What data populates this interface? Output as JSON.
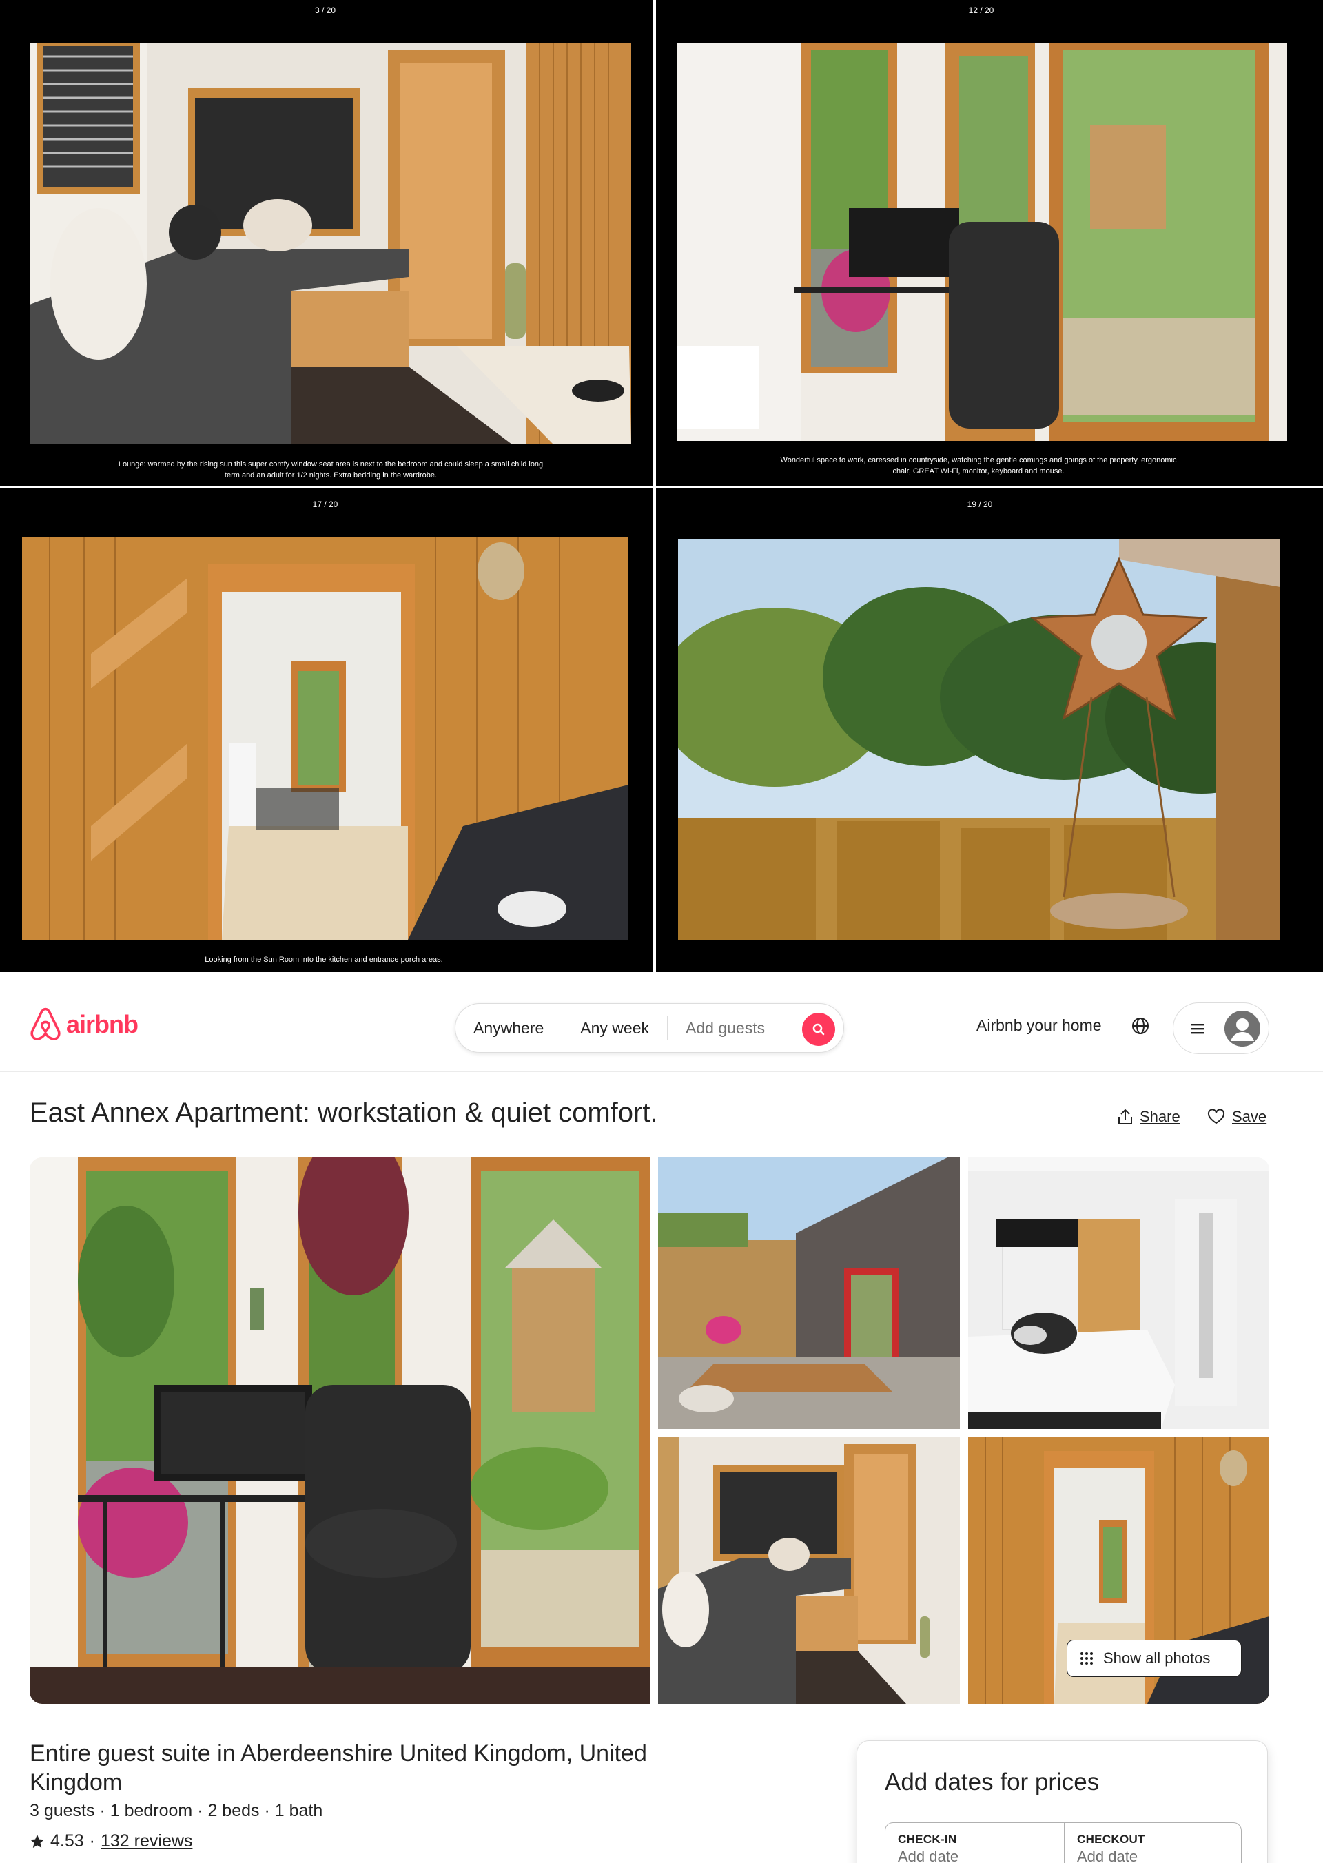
{
  "lightbox": {
    "panels": [
      {
        "counter": "3 / 20",
        "caption": "Lounge: warmed by the rising sun this super comfy window seat area is next to the bedroom and could sleep a small child long term and an adult for 1/2 nights. Extra bedding in the wardrobe."
      },
      {
        "counter": "12 / 20",
        "caption": "Wonderful space to work, caressed in countryside, watching the gentle comings and goings of the property, ergonomic chair, GREAT Wi-Fi, monitor, keyboard and mouse."
      },
      {
        "counter": "17 / 20",
        "caption": "Looking from the Sun Room into the kitchen and entrance porch areas."
      },
      {
        "counter": "19 / 20",
        "caption": ""
      }
    ]
  },
  "header": {
    "logo_text": "airbnb",
    "search": {
      "anywhere": "Anywhere",
      "any_week": "Any week",
      "add_guests": "Add guests"
    },
    "host_link": "Airbnb your home",
    "brand_color": "#ff385c"
  },
  "listing": {
    "title": "East Annex Apartment: workstation & quiet comfort.",
    "share_label": "Share",
    "save_label": "Save",
    "show_all_photos": "Show all photos",
    "type_location": "Entire guest suite in Aberdeenshire United Kingdom, United Kingdom",
    "details": "3 guests · 1 bedroom · 2 beds · 1 bath",
    "rating": "4.53",
    "separator": "·",
    "reviews": "132 reviews"
  },
  "booking": {
    "heading": "Add dates for prices",
    "checkin_label": "CHECK-IN",
    "checkout_label": "CHECKOUT",
    "checkin_value": "Add date",
    "checkout_value": "Add date"
  }
}
